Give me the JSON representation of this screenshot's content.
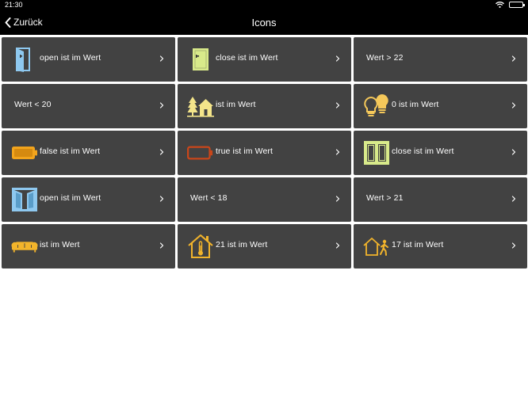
{
  "status": {
    "time": "21:30"
  },
  "nav": {
    "back_label": "Zurück",
    "title": "Icons"
  },
  "tiles": [
    {
      "label": "open ist im Wert",
      "icon": "door-open-icon",
      "color": "#8ec8ef"
    },
    {
      "label": "close ist im Wert",
      "icon": "door-closed-icon",
      "color": "#d8ea8a"
    },
    {
      "label": "Wert > 22",
      "icon": ""
    },
    {
      "label": "Wert < 20",
      "icon": ""
    },
    {
      "label": "ist im Wert",
      "icon": "garden-house-icon",
      "color": "#f4e58a"
    },
    {
      "label": "0 ist im Wert",
      "icon": "light-bulbs-icon",
      "color": "#f5c85a"
    },
    {
      "label": "false ist im Wert",
      "icon": "battery-full-icon",
      "color": "#f2a41c"
    },
    {
      "label": "true ist im Wert",
      "icon": "battery-empty-icon",
      "color": "#c9461a"
    },
    {
      "label": "close ist im Wert",
      "icon": "window-closed-icon",
      "color": "#d8ea8a"
    },
    {
      "label": "open ist im Wert",
      "icon": "window-open-icon",
      "color": "#8ec8ef"
    },
    {
      "label": "Wert < 18",
      "icon": ""
    },
    {
      "label": "Wert > 21",
      "icon": ""
    },
    {
      "label": "ist im Wert",
      "icon": "sofa-icon",
      "color": "#f2b42b"
    },
    {
      "label": "21 ist im Wert",
      "icon": "house-thermometer-icon",
      "color": "#f2b42b"
    },
    {
      "label": "17 ist im Wert",
      "icon": "house-presence-icon",
      "color": "#f2b42b"
    }
  ]
}
